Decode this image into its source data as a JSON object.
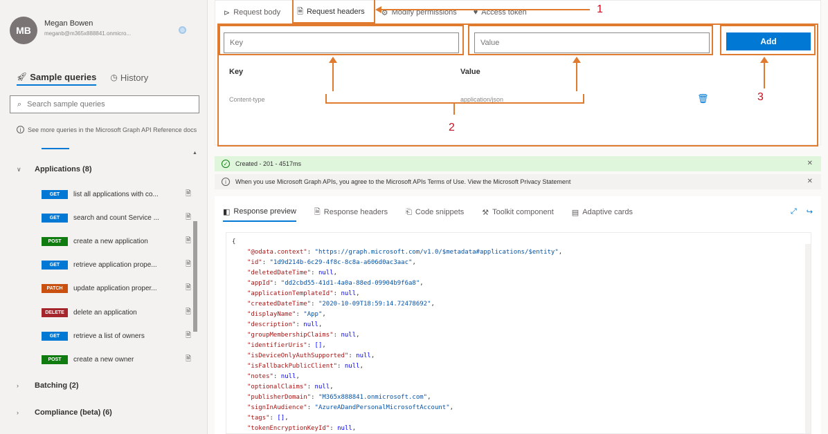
{
  "profile": {
    "initials": "MB",
    "name": "Megan Bowen",
    "email": "meganb@m365x888841.onmicro..."
  },
  "sidebar": {
    "tabs": [
      {
        "label": "Sample queries",
        "icon": "rocket-icon"
      },
      {
        "label": "History",
        "icon": "history-icon"
      }
    ],
    "search_placeholder": "Search sample queries",
    "info_text": "See more queries in the Microsoft Graph API Reference docs",
    "groups": [
      {
        "label": "Applications (8)",
        "expanded": true
      },
      {
        "label": "Batching (2)",
        "expanded": false
      },
      {
        "label": "Compliance (beta) (6)",
        "expanded": false
      }
    ],
    "queries": [
      {
        "method": "GET",
        "label": "list all applications with co..."
      },
      {
        "method": "GET",
        "label": "search and count Service ..."
      },
      {
        "method": "POST",
        "label": "create a new application"
      },
      {
        "method": "GET",
        "label": "retrieve application prope..."
      },
      {
        "method": "PATCH",
        "label": "update application proper..."
      },
      {
        "method": "DELETE",
        "label": "delete an application"
      },
      {
        "method": "GET",
        "label": "retrieve a list of owners"
      },
      {
        "method": "POST",
        "label": "create a new owner"
      }
    ]
  },
  "request": {
    "tabs": [
      {
        "label": "Request body",
        "icon": "body-icon",
        "active": false
      },
      {
        "label": "Request headers",
        "icon": "headers-icon",
        "active": true
      },
      {
        "label": "Modify permissions",
        "icon": "permissions-icon",
        "active": false
      },
      {
        "label": "Access token",
        "icon": "token-icon",
        "active": false
      }
    ],
    "key_placeholder": "Key",
    "value_placeholder": "Value",
    "add_label": "Add",
    "columns": {
      "key": "Key",
      "value": "Value"
    },
    "rows": [
      {
        "key": "Content-type",
        "value": "application/json"
      }
    ]
  },
  "annotations": {
    "one": "1",
    "two": "2",
    "three": "3"
  },
  "banners": {
    "success": "Created - 201 - 4517ms",
    "info": "When you use Microsoft Graph APIs, you agree to the Microsoft APIs Terms of Use. View the Microsoft Privacy Statement"
  },
  "response": {
    "tabs": [
      {
        "label": "Response preview",
        "icon": "preview-icon",
        "active": true
      },
      {
        "label": "Response headers",
        "icon": "doc-icon",
        "active": false
      },
      {
        "label": "Code snippets",
        "icon": "code-icon",
        "active": false
      },
      {
        "label": "Toolkit component",
        "icon": "toolkit-icon",
        "active": false
      },
      {
        "label": "Adaptive cards",
        "icon": "cards-icon",
        "active": false
      }
    ],
    "json_lines": [
      {
        "key": "\"@odata.context\"",
        "value": "\"https://graph.microsoft.com/v1.0/$metadata#applications/$entity\"",
        "type": "s"
      },
      {
        "key": "\"id\"",
        "value": "\"1d9d214b-6c29-4f8c-8c8a-a606d0ac3aac\"",
        "type": "s"
      },
      {
        "key": "\"deletedDateTime\"",
        "value": "null",
        "type": "n"
      },
      {
        "key": "\"appId\"",
        "value": "\"dd2cbd55-41d1-4a0a-88ed-09904b9f6a8\"",
        "type": "s"
      },
      {
        "key": "\"applicationTemplateId\"",
        "value": "null",
        "type": "n"
      },
      {
        "key": "\"createdDateTime\"",
        "value": "\"2020-10-09T18:59:14.72478692\"",
        "type": "s"
      },
      {
        "key": "\"displayName\"",
        "value": "\"App\"",
        "type": "s"
      },
      {
        "key": "\"description\"",
        "value": "null",
        "type": "n"
      },
      {
        "key": "\"groupMembershipClaims\"",
        "value": "null",
        "type": "n"
      },
      {
        "key": "\"identifierUris\"",
        "value": "[]",
        "type": "n"
      },
      {
        "key": "\"isDeviceOnlyAuthSupported\"",
        "value": "null",
        "type": "n"
      },
      {
        "key": "\"isFallbackPublicClient\"",
        "value": "null",
        "type": "n"
      },
      {
        "key": "\"notes\"",
        "value": "null",
        "type": "n"
      },
      {
        "key": "\"optionalClaims\"",
        "value": "null",
        "type": "n"
      },
      {
        "key": "\"publisherDomain\"",
        "value": "\"M365x888841.onmicrosoft.com\"",
        "type": "s"
      },
      {
        "key": "\"signInAudience\"",
        "value": "\"AzureADandPersonalMicrosoftAccount\"",
        "type": "s"
      },
      {
        "key": "\"tags\"",
        "value": "[]",
        "type": "n"
      },
      {
        "key": "\"tokenEncryptionKeyId\"",
        "value": "null",
        "type": "n"
      }
    ]
  },
  "colors": {
    "accent": "#0078d4",
    "annotation": "#e07a2e",
    "annotation_number": "#c50f1f",
    "get": "#0078d4",
    "post": "#107c10",
    "patch": "#ca5010",
    "delete": "#a4262c",
    "success_bg": "#dff6dd"
  }
}
